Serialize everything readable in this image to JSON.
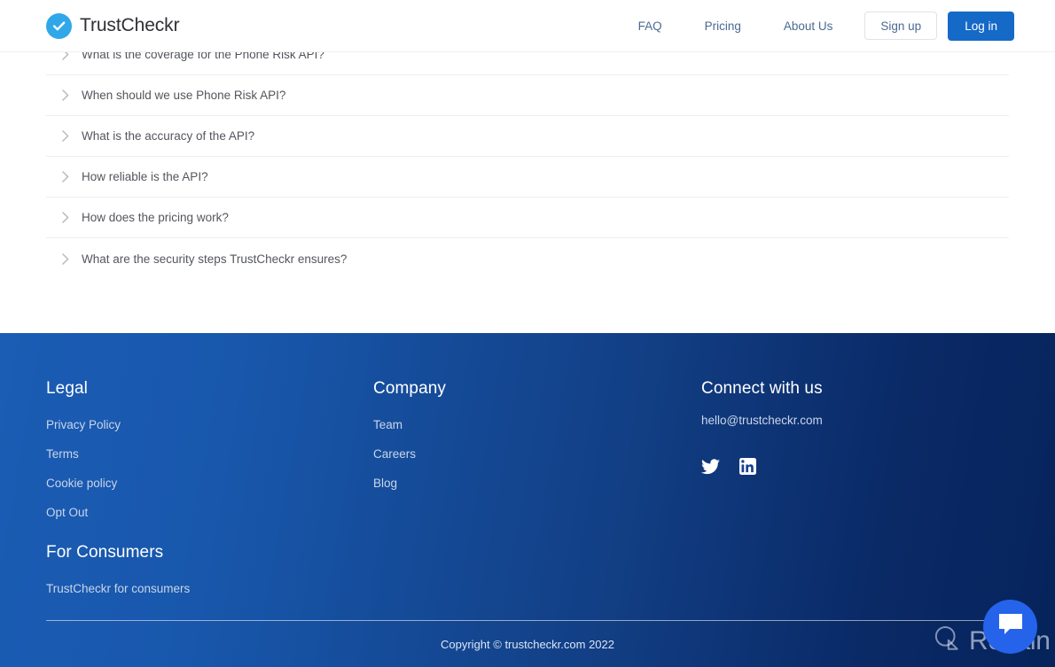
{
  "header": {
    "brand_name": "TrustCheckr",
    "brand_icon": "check-circle-icon",
    "nav_links": [
      {
        "label": "FAQ"
      },
      {
        "label": "Pricing"
      },
      {
        "label": "About Us"
      }
    ],
    "signup_label": "Sign up",
    "login_label": "Log in",
    "login_bg": "#1569c7",
    "nav_text_color": "#4b6a93"
  },
  "faq": {
    "chevron_icon": "chevron-right-icon",
    "items": [
      {
        "question": "What is the coverage for the Phone Risk API?"
      },
      {
        "question": "When should we use Phone Risk API?"
      },
      {
        "question": "What is the accuracy of the API?"
      },
      {
        "question": "How reliable is the API?"
      },
      {
        "question": "How does the pricing work?"
      },
      {
        "question": "What are the security steps TrustCheckr ensures?"
      }
    ]
  },
  "footer": {
    "gradient_from": "#1b5cb4",
    "gradient_to": "#06235b",
    "legal": {
      "title": "Legal",
      "links": [
        {
          "label": "Privacy Policy"
        },
        {
          "label": "Terms"
        },
        {
          "label": "Cookie policy"
        },
        {
          "label": "Opt Out"
        }
      ],
      "consumers_title": "For Consumers",
      "consumers_links": [
        {
          "label": "TrustCheckr for consumers"
        }
      ]
    },
    "company": {
      "title": "Company",
      "links": [
        {
          "label": "Team"
        },
        {
          "label": "Careers"
        },
        {
          "label": "Blog"
        }
      ]
    },
    "connect": {
      "title": "Connect with us",
      "email": "hello@trustcheckr.com",
      "socials": [
        {
          "name": "twitter-icon"
        },
        {
          "name": "linkedin-icon"
        }
      ]
    },
    "copyright": "Copyright © trustcheckr.com 2022"
  },
  "widgets": {
    "chat": {
      "icon": "chat-bubble-icon",
      "bg": "#2563eb"
    },
    "watermark": {
      "text": "Revain",
      "icon": "revain-logo-icon"
    }
  }
}
